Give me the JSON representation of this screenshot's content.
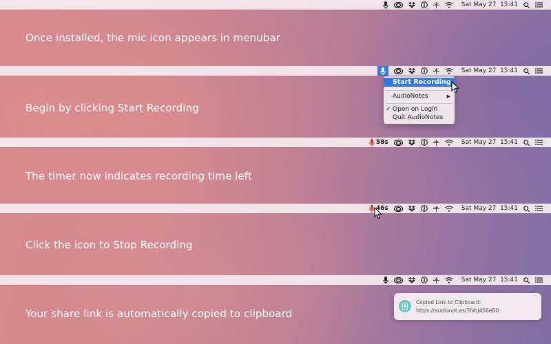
{
  "clock": "Sat May 27  15:41",
  "panels": [
    {
      "caption": "Once installed, the mic icon appears in menubar"
    },
    {
      "caption": "Begin by clicking Start Recording"
    },
    {
      "caption": "The timer now indicates recording time left",
      "timer": "58s"
    },
    {
      "caption": "Click the icon to Stop Recording",
      "timer": "46s"
    },
    {
      "caption": "Your share link is automatically copied to clipboard"
    }
  ],
  "menu": {
    "start_recording": "Start Recording",
    "audionotes": "AudioNotes",
    "open_on_login": "Open on Login",
    "open_on_login_check": "✓",
    "quit": "Quit AudioNotes",
    "submenu_arrow": "▶"
  },
  "notification": {
    "title": "Copied Link to Clipboard:",
    "url": "https://audionot.es/3lVoj4S6eB0"
  },
  "icons": [
    "mic-icon",
    "creative-cloud-icon",
    "dropbox-icon",
    "1password-icon",
    "network-icon",
    "wifi-icon",
    "spotlight-icon",
    "notification-center-icon"
  ],
  "colors": {
    "recording_red": "#e0322e",
    "highlight_blue": "#3478e5",
    "notif_teal": "#68c7c7"
  }
}
